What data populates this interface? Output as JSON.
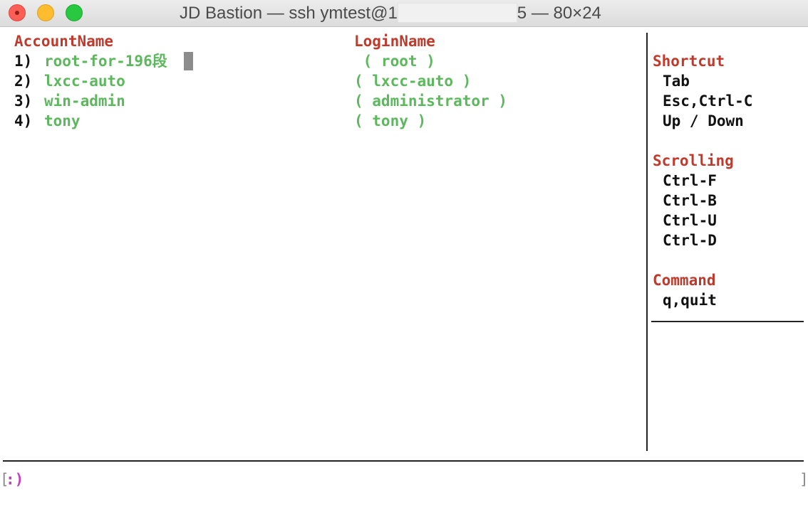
{
  "window": {
    "title_prefix": "JD Bastion — ssh ymtest@1",
    "title_tail": "5 — 80×24"
  },
  "accounts": {
    "header_account": "AccountName",
    "header_login": "LoginName",
    "rows": [
      {
        "index": "1)",
        "account": "root-for-196段",
        "login": " ( root )"
      },
      {
        "index": "2)",
        "account": "lxcc-auto",
        "login": "( lxcc-auto )"
      },
      {
        "index": "3)",
        "account": "win-admin",
        "login": "( administrator )"
      },
      {
        "index": "4)",
        "account": "tony",
        "login": "( tony )"
      }
    ]
  },
  "help": {
    "shortcut": {
      "title": "Shortcut",
      "items": [
        "Tab",
        "Esc,Ctrl-C",
        "Up / Down"
      ]
    },
    "scrolling": {
      "title": "Scrolling",
      "items": [
        "Ctrl-F",
        "Ctrl-B",
        "Ctrl-U",
        "Ctrl-D"
      ]
    },
    "command": {
      "title": "Command",
      "items": [
        "q,quit"
      ]
    }
  },
  "prompt": {
    "left_bracket": "[",
    "text": ":)",
    "right_bracket": "]"
  },
  "colors": {
    "header_red": "#c0392b",
    "entry_green": "#5cb85c",
    "prompt_magenta": "#c23fc2"
  }
}
